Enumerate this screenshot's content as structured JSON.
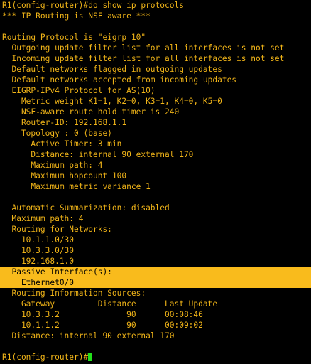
{
  "terminal": {
    "lines": [
      "R1(config-router)#do show ip protocols",
      "*** IP Routing is NSF aware ***",
      "",
      "Routing Protocol is \"eigrp 10\"",
      "  Outgoing update filter list for all interfaces is not set",
      "  Incoming update filter list for all interfaces is not set",
      "  Default networks flagged in outgoing updates",
      "  Default networks accepted from incoming updates",
      "  EIGRP-IPv4 Protocol for AS(10)",
      "    Metric weight K1=1, K2=0, K3=1, K4=0, K5=0",
      "    NSF-aware route hold timer is 240",
      "    Router-ID: 192.168.1.1",
      "    Topology : 0 (base)",
      "      Active Timer: 3 min",
      "      Distance: internal 90 external 170",
      "      Maximum path: 4",
      "      Maximum hopcount 100",
      "      Maximum metric variance 1",
      "",
      "  Automatic Summarization: disabled",
      "  Maximum path: 4",
      "  Routing for Networks:",
      "    10.1.1.0/30",
      "    10.3.3.0/30",
      "    192.168.1.0",
      "  Passive Interface(s):",
      "    Ethernet0/0",
      "  Routing Information Sources:",
      "    Gateway         Distance      Last Update",
      "    10.3.3.2              90      00:08:46",
      "    10.1.1.2              90      00:09:02",
      "  Distance: internal 90 external 170",
      ""
    ],
    "prompt": "R1(config-router)#",
    "colors": {
      "background": "#000000",
      "text": "#f0b418",
      "highlight": "#f9bb1c",
      "cursor": "#22e01a"
    }
  }
}
